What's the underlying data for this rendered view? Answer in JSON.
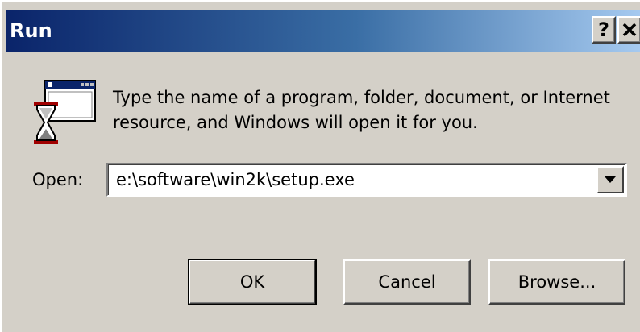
{
  "window": {
    "title": "Run",
    "help_label": "?",
    "close_label": "✕"
  },
  "dialog": {
    "description": "Type the name of a program, folder, document, or Internet resource, and Windows will open it for you.",
    "open_label": "Open:",
    "open_value": "e:\\software\\win2k\\setup.exe"
  },
  "buttons": {
    "ok": "OK",
    "cancel": "Cancel",
    "browse": "Browse..."
  },
  "icons": {
    "run": "run-program-icon",
    "dropdown": "chevron-down-icon"
  },
  "colors": {
    "titlebar_start": "#0a246a",
    "titlebar_end": "#a6caf0",
    "face": "#d4d0c8"
  }
}
